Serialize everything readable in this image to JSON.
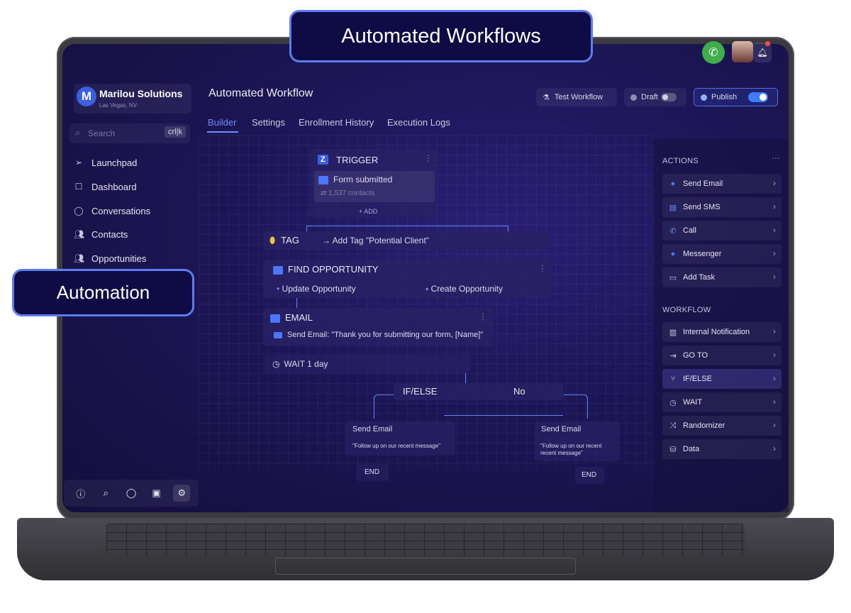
{
  "callouts": {
    "top": "Automated Workflows",
    "left": "Automation"
  },
  "brand": {
    "name": "Marilou Solutions",
    "location": "Las Vegas, NV",
    "logo_letter": "M"
  },
  "search": {
    "placeholder": "Search",
    "shortcut": "crl|k"
  },
  "sidebar": {
    "items": [
      {
        "label": "Launchpad",
        "icon": "launchpad-icon"
      },
      {
        "label": "Dashboard",
        "icon": "dashboard-icon"
      },
      {
        "label": "Conversations",
        "icon": "chat-icon"
      },
      {
        "label": "Contacts",
        "icon": "contacts-icon"
      },
      {
        "label": "Opportunities",
        "icon": "opportunities-icon"
      }
    ],
    "bottom_icons": [
      "info-icon",
      "search-icon",
      "chat-icon",
      "calendar-icon",
      "settings-icon"
    ]
  },
  "header": {
    "title": "Automated Workflow",
    "tabs": [
      "Builder",
      "Settings",
      "Enrollment History",
      "Execution Logs"
    ],
    "active_tab": "Builder",
    "test_workflow": "Test Workflow",
    "draft": "Draft",
    "publish": "Publish",
    "publish_on": true
  },
  "workflow": {
    "trigger": {
      "badge": "Z",
      "label": "TRIGGER",
      "event": "Form submitted",
      "contacts": "1,537 contacts",
      "add": "+ ADD"
    },
    "tag": {
      "label": "TAG",
      "action": "Add Tag \"Potential Client\""
    },
    "find_opportunity": {
      "label": "FIND OPPORTUNITY",
      "option_a": "Update Opportunity",
      "option_b": "Create Opportunity"
    },
    "email": {
      "label": "EMAIL",
      "action": "Send Email: \"Thank you for submitting our form, [Name]\""
    },
    "wait": {
      "label": "WAIT 1 day"
    },
    "ifelse": {
      "label": "IF/ELSE",
      "branch": "No"
    },
    "left_branch": {
      "title": "Send Email",
      "message": "\"Follow up on our recent message\"",
      "end": "END"
    },
    "right_branch": {
      "title": "Send Email",
      "message": "\"Follow up on our recent recent message\"",
      "end": "END"
    }
  },
  "actions_panel": {
    "heading": "ACTIONS",
    "items": [
      {
        "label": "Send Email",
        "icon": "email-icon"
      },
      {
        "label": "Send SMS",
        "icon": "sms-icon"
      },
      {
        "label": "Call",
        "icon": "phone-icon"
      },
      {
        "label": "Messenger",
        "icon": "messenger-icon"
      },
      {
        "label": "Add Task",
        "icon": "task-icon"
      }
    ]
  },
  "workflow_panel": {
    "heading": "WORKFLOW",
    "items": [
      {
        "label": "Internal Notification",
        "icon": "notification-icon"
      },
      {
        "label": "GO TO",
        "icon": "goto-icon"
      },
      {
        "label": "IF/ELSE",
        "icon": "branch-icon"
      },
      {
        "label": "WAIT",
        "icon": "clock-icon"
      },
      {
        "label": "Randomizer",
        "icon": "randomizer-icon"
      },
      {
        "label": "Data",
        "icon": "database-icon"
      }
    ]
  },
  "colors": {
    "accent": "#5d7cf0",
    "screen_bg": "#1c1656",
    "callout_bg": "#0e0b45",
    "call_green": "#3fae4a"
  }
}
